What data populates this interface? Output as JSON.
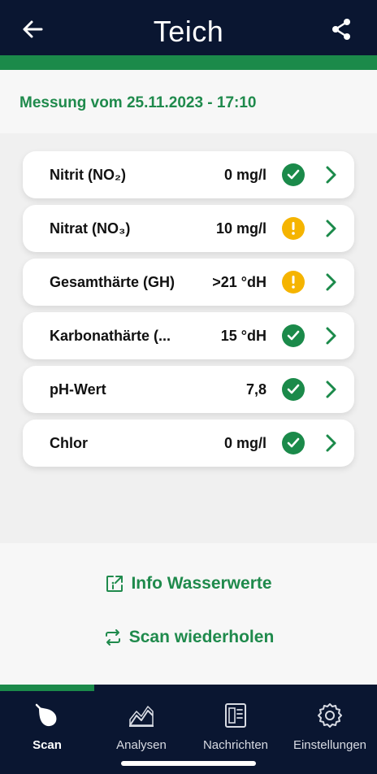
{
  "header": {
    "title": "Teich",
    "back_icon": "arrow-left-icon",
    "share_icon": "share-icon",
    "background_color": "#0a1631",
    "accent_color": "#1b8a4a"
  },
  "measurement": {
    "label": "Messung vom 25.11.2023 - 17:10",
    "color": "#1f8a4c"
  },
  "results": [
    {
      "name": "Nitrit (NO₂)",
      "value": "0 mg/l",
      "status": "ok"
    },
    {
      "name": "Nitrat (NO₃)",
      "value": "10 mg/l",
      "status": "warning"
    },
    {
      "name": "Gesamthärte (GH)",
      "value": ">21 °dH",
      "status": "warning"
    },
    {
      "name": "Karbonathärte (...",
      "value": "15 °dH",
      "status": "ok"
    },
    {
      "name": "pH-Wert",
      "value": "7,8",
      "status": "ok"
    },
    {
      "name": "Chlor",
      "value": "0 mg/l",
      "status": "ok"
    }
  ],
  "status_colors": {
    "ok": "#1b8a4a",
    "warning": "#f5b400"
  },
  "actions": {
    "info_label": "Info Wasserwerte",
    "info_icon": "external-info-icon",
    "rescan_label": "Scan wiederholen",
    "rescan_icon": "repeat-icon"
  },
  "tabbar": {
    "items": [
      {
        "label": "Scan",
        "icon": "scan-drop-icon",
        "active": true
      },
      {
        "label": "Analysen",
        "icon": "chart-icon",
        "active": false
      },
      {
        "label": "Nachrichten",
        "icon": "news-icon",
        "active": false
      },
      {
        "label": "Einstellungen",
        "icon": "gear-icon",
        "active": false
      }
    ]
  }
}
